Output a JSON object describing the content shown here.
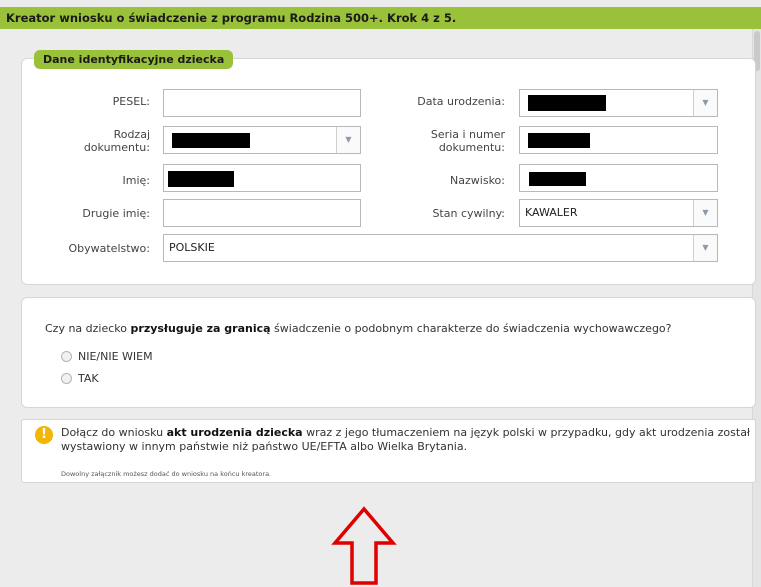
{
  "header": {
    "title": "Kreator wniosku o świadczenie z programu Rodzina 500+. Krok 4 z 5."
  },
  "child_section": {
    "title": "Dane identyfikacyjne dziecka",
    "fields": {
      "pesel": {
        "label": "PESEL:",
        "value": ""
      },
      "birth_date": {
        "label": "Data urodzenia:",
        "value": ""
      },
      "doc_type": {
        "label_line1": "Rodzaj",
        "label_line2": "dokumentu:",
        "value": ""
      },
      "doc_number": {
        "label_line1": "Seria i numer",
        "label_line2": "dokumentu:",
        "value": ""
      },
      "first_name": {
        "label": "Imię:",
        "value": ""
      },
      "last_name": {
        "label": "Nazwisko:",
        "value": ""
      },
      "second_name": {
        "label": "Drugie imię:",
        "value": ""
      },
      "marital_status": {
        "label": "Stan cywilny:",
        "value": "KAWALER"
      },
      "citizenship": {
        "label": "Obywatelstwo:",
        "value": "POLSKIE"
      }
    }
  },
  "abroad_question": {
    "text_before": "Czy na dziecko ",
    "text_bold": "przysługuje za granicą",
    "text_after": " świadczenie o podobnym charakterze do świadczenia wychowawczego?",
    "options": [
      "NIE/NIE WIEM",
      "TAK"
    ]
  },
  "info": {
    "text_before": "Dołącz do wniosku ",
    "text_bold": "akt urodzenia dziecka",
    "text_after": " wraz z jego tłumaczeniem na język polski w przypadku, gdy akt urodzenia został wystawiony w innym państwie niż państwo UE/EFTA albo Wielka Brytania.",
    "note": "Dowolny załącznik możesz dodać do wniosku na końcu kreatora."
  },
  "icons": {
    "dropdown": "chevron-down-icon",
    "info": "info-icon",
    "annotation": "up-arrow-icon"
  },
  "colors": {
    "accent": "#9ac13a",
    "annotation": "#e00000",
    "info": "#f2b705"
  }
}
